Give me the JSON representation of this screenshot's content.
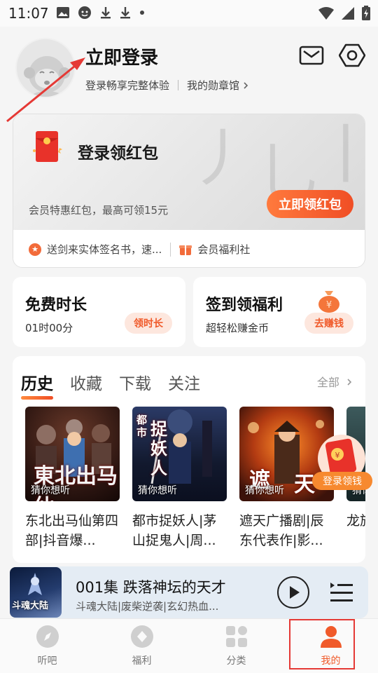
{
  "status_bar": {
    "time": "11:07"
  },
  "header": {
    "login_title": "立即登录",
    "login_subtitle": "登录畅享完整体验",
    "medals_link": "我的勋章馆"
  },
  "red_packet_card": {
    "title": "登录领红包",
    "description": "会员特惠红包，最高可领15元",
    "cta": "立即领红包",
    "benefits": [
      {
        "label": "送剑来实体签名书，速..."
      },
      {
        "label": "会员福利社"
      }
    ]
  },
  "free_time_card": {
    "title": "免费时长",
    "subtitle": "01时00分",
    "button": "领时长"
  },
  "checkin_card": {
    "title": "签到领福利",
    "subtitle": "超轻松赚金币",
    "button": "去赚钱"
  },
  "history": {
    "tabs": [
      {
        "label": "历史",
        "active": true
      },
      {
        "label": "收藏"
      },
      {
        "label": "下载"
      },
      {
        "label": "关注"
      }
    ],
    "see_all": "全部",
    "items": [
      {
        "cover_tag": "猜你想听",
        "title": "东北出马仙第四部|抖音爆..."
      },
      {
        "cover_tag": "猜你想听",
        "title": "都市捉妖人|茅山捉鬼人|周..."
      },
      {
        "cover_tag": "猜你想听",
        "title": "遮天广播剧|辰东代表作|影..."
      },
      {
        "cover_tag": "猜你",
        "title": "龙族襟第..."
      }
    ]
  },
  "floating_badge": {
    "label": "登录领钱"
  },
  "player": {
    "episode_title": "001集 跌落神坛的天才",
    "subtitle": "斗魂大陆|废柴逆袭|玄幻热血...",
    "thumb_text": "斗魂大陆"
  },
  "nav": [
    {
      "label": "听吧",
      "icon": "compass-icon"
    },
    {
      "label": "福利",
      "icon": "coin-icon"
    },
    {
      "label": "分类",
      "icon": "grid-icon"
    },
    {
      "label": "我的",
      "icon": "person-icon",
      "active": true
    }
  ],
  "colors": {
    "accent": "#f05a2a",
    "highlight_box": "#e53935",
    "annotation_arrow": "#e53935"
  }
}
